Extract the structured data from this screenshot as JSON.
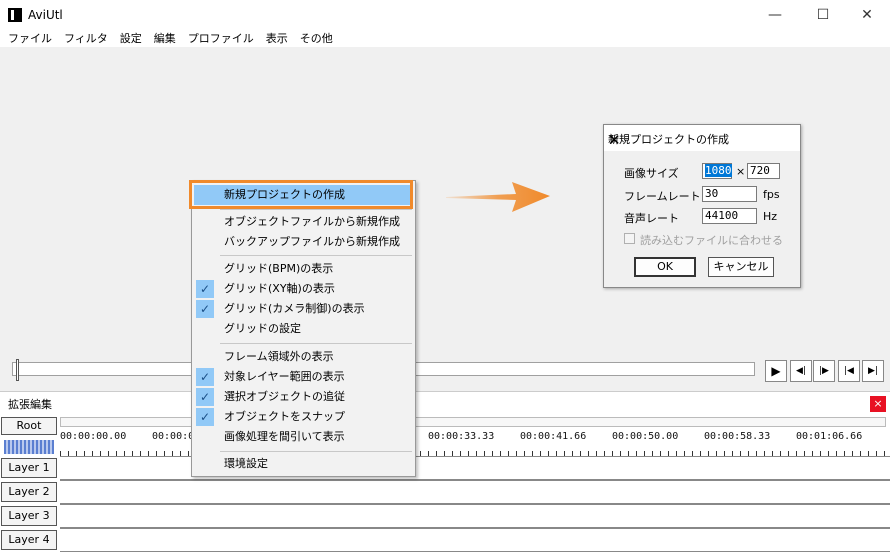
{
  "window": {
    "title": "AviUtl",
    "minimize": "—",
    "maximize": "☐",
    "close": "✕"
  },
  "menubar": [
    "ファイル",
    "フィルタ",
    "設定",
    "編集",
    "プロファイル",
    "表示",
    "その他"
  ],
  "playback": {
    "play": "▶",
    "prev_frame": "◀|",
    "next_frame": "|▶",
    "first_frame": "|◀",
    "last_frame": "▶|"
  },
  "extension_edit": {
    "title": "拡張編集",
    "close": "×",
    "root_label": "Root",
    "ruler": [
      "00:00:00.00",
      "00:00:08",
      "00:00:33.33",
      "00:00:41.66",
      "00:00:50.00",
      "00:00:58.33",
      "00:01:06.66"
    ],
    "layers": [
      "Layer 1",
      "Layer 2",
      "Layer 3",
      "Layer 4"
    ]
  },
  "context_menu": {
    "groups": [
      [
        {
          "label": "新規プロジェクトの作成",
          "checked": false,
          "highlighted": true
        }
      ],
      [
        {
          "label": "オブジェクトファイルから新規作成",
          "checked": false
        },
        {
          "label": "バックアップファイルから新規作成",
          "checked": false
        }
      ],
      [
        {
          "label": "グリッド(BPM)の表示",
          "checked": false
        },
        {
          "label": "グリッド(XY軸)の表示",
          "checked": true
        },
        {
          "label": "グリッド(カメラ制御)の表示",
          "checked": true
        },
        {
          "label": "グリッドの設定",
          "checked": false
        }
      ],
      [
        {
          "label": "フレーム領域外の表示",
          "checked": false
        },
        {
          "label": "対象レイヤー範囲の表示",
          "checked": true
        },
        {
          "label": "選択オブジェクトの追従",
          "checked": true
        },
        {
          "label": "オブジェクトをスナップ",
          "checked": true
        },
        {
          "label": "画像処理を間引いて表示",
          "checked": false
        }
      ],
      [
        {
          "label": "環境設定",
          "checked": false
        }
      ]
    ]
  },
  "dialog": {
    "title": "新規プロジェクトの作成",
    "close": "✕",
    "image_size_label": "画像サイズ",
    "width": "1080",
    "times": "×",
    "height": "720",
    "framerate_label": "フレームレート",
    "framerate": "30",
    "framerate_unit": "fps",
    "audiorate_label": "音声レート",
    "audiorate": "44100",
    "audiorate_unit": "Hz",
    "match_file_label": "読み込むファイルに合わせる",
    "ok": "OK",
    "cancel": "キャンセル"
  },
  "colors": {
    "highlight": "#91c9f7",
    "annotation": "#f08a2b"
  }
}
